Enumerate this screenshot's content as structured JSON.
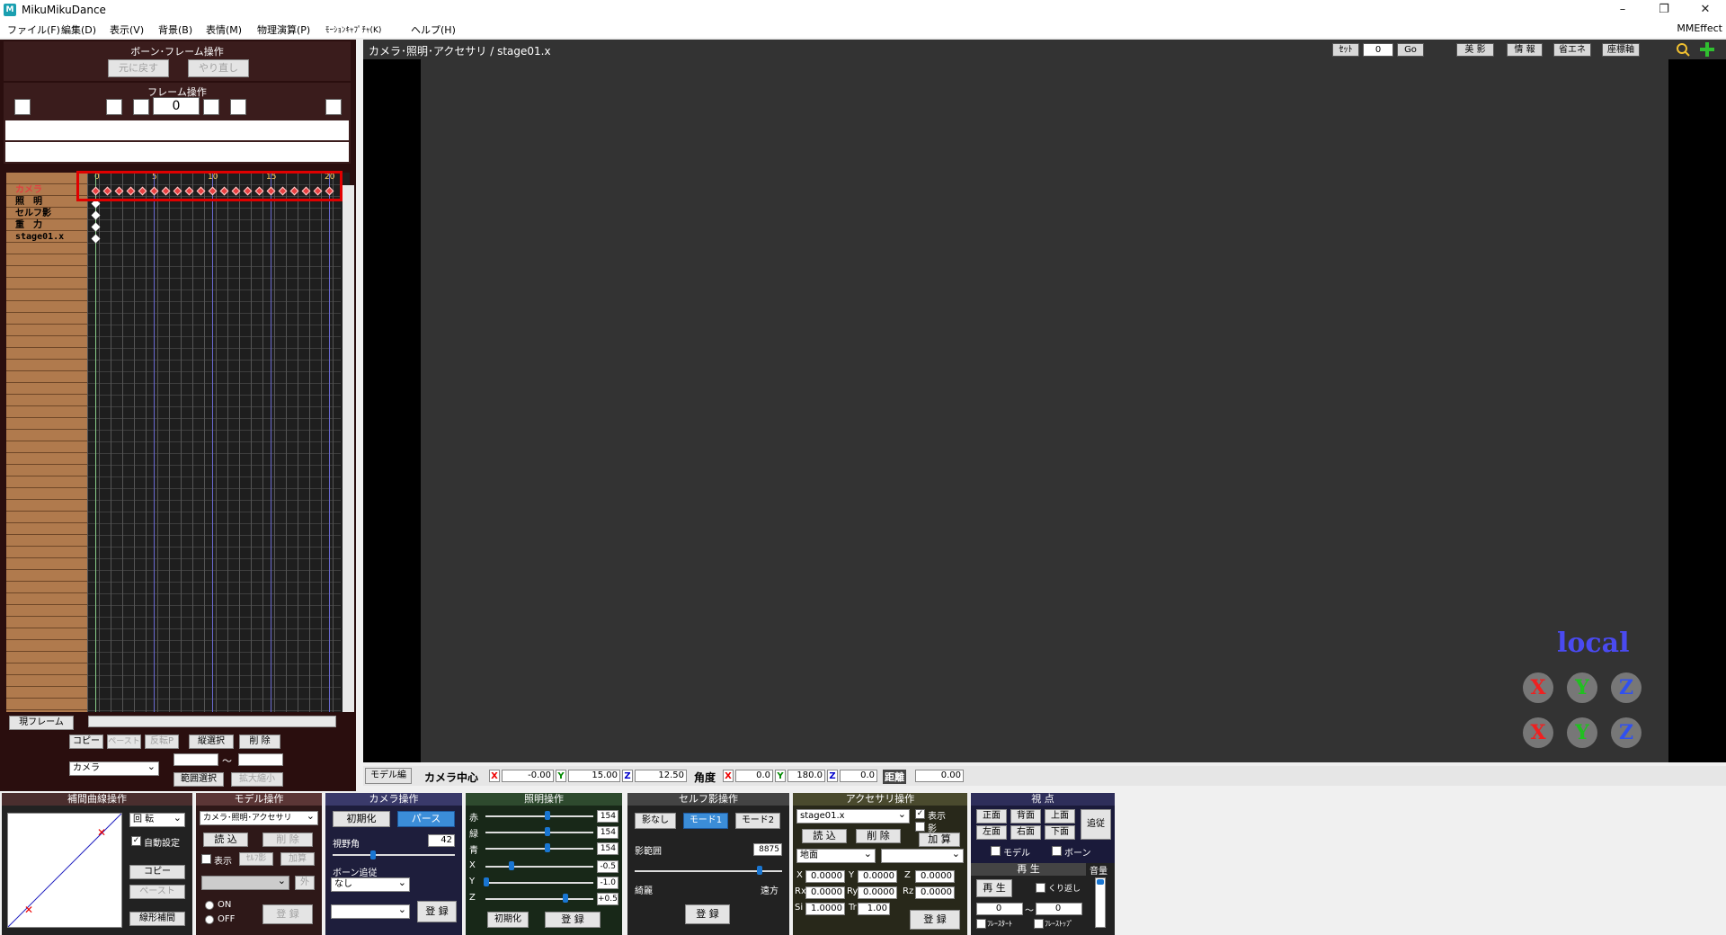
{
  "titlebar": {
    "app_title": "MikuMikuDance",
    "icon_text": "M",
    "min": "–",
    "max": "❐",
    "close": "✕"
  },
  "menu": [
    "ファイル(F)",
    "編集(D)",
    "表示(V)",
    "背景(B)",
    "表情(M)",
    "物理演算(P)",
    "ﾓｰｼｮﾝｷｬﾌﾟﾁｬ(K)",
    "ヘルプ(H)"
  ],
  "menu_right": "MMEffect",
  "bone_frame": {
    "title": "ボーン･フレーム操作",
    "undo": "元に戻す",
    "redo": "やり直し"
  },
  "frame_ops": {
    "title": "フレーム操作",
    "frame_value": "0",
    "first": "|<",
    "prev_key": ".<",
    "prev": "<",
    "next": ">",
    "next_key": ">.",
    "last": ">|"
  },
  "timeline": {
    "ticks": [
      "0",
      "5",
      "10",
      "15",
      "20"
    ],
    "rows": [
      "カメラ",
      "照　明",
      "セルフ影",
      "重　力",
      "stage01.x"
    ]
  },
  "frame_bottom": {
    "current_frame": "現フレーム",
    "copy": "コピー",
    "paste": "ペースト",
    "reverse_paste": "反転P",
    "vert_select": "縦選択",
    "delete": "削 除",
    "target": "カメラ",
    "range_from": "",
    "range_to": "",
    "tilde": "～",
    "range_select": "範囲選択",
    "expand": "拡大縮小"
  },
  "viewport": {
    "title": "カメラ･照明･アクセサリ / stage01.x",
    "set_label": "ｾｯﾄ",
    "set_value": "0",
    "go": "Go",
    "beauty": "美 影",
    "info": "情 報",
    "eco": "省エネ",
    "coord": "座標軸",
    "local_label": "local",
    "gizmo_top": [
      "X",
      "Y",
      "Z"
    ],
    "gizmo_bottom": [
      "X",
      "Y",
      "Z"
    ]
  },
  "camstatus": {
    "model_edit": "モデル編",
    "center_label": "カメラ中心",
    "cx": "-0.00",
    "cy": "15.00",
    "cz": "12.50",
    "angle_label": "角度",
    "ax": "0.0",
    "ay": "180.0",
    "az": "0.0",
    "dist_label": "距離",
    "dist": "0.00",
    "x": "X",
    "y": "Y",
    "z": "Z"
  },
  "interp": {
    "title": "補間曲線操作",
    "rotate": "回 転",
    "auto": "自動設定",
    "copy": "コピー",
    "paste": "ペースト",
    "linear": "線形補間"
  },
  "model_ops": {
    "title": "モデル操作",
    "model_select": "カメラ･照明･アクセサリ",
    "load": "読 込",
    "delete": "削 除",
    "show": "表示",
    "self_shadow": "ｾﾙﾌ影",
    "add": "加算",
    "outer": "外",
    "on": "ON",
    "off": "OFF",
    "register": "登 録"
  },
  "camera_ops": {
    "title": "カメラ操作",
    "init": "初期化",
    "perspective": "パース",
    "fov_label": "視野角",
    "fov": "42",
    "follow_label": "ボーン追従",
    "follow_value": "なし",
    "register": "登 録"
  },
  "light_ops": {
    "title": "照明操作",
    "r_label": "赤",
    "g_label": "緑",
    "b_label": "青",
    "r": "154",
    "g": "154",
    "b": "154",
    "x_label": "X",
    "y_label": "Y",
    "z_label": "Z",
    "x": "-0.5",
    "y": "-1.0",
    "z": "+0.5",
    "init": "初期化",
    "register": "登 録"
  },
  "self_shadow": {
    "title": "セルフ影操作",
    "none": "影なし",
    "mode1": "モード1",
    "mode2": "モード2",
    "range_label": "影範囲",
    "range_value": "8875",
    "near": "綺麗",
    "far": "遠方",
    "register": "登 録"
  },
  "accessory": {
    "title": "アクセサリ操作",
    "name": "stage01.x",
    "show": "表示",
    "shadow": "影",
    "load": "読 込",
    "delete": "削 除",
    "add": "加 算",
    "ground": "地面",
    "x": "0.0000",
    "y": "0.0000",
    "z": "0.0000",
    "rx": "0.0000",
    "ry": "0.0000",
    "rz": "0.0000",
    "si": "1.0000",
    "tr": "1.00",
    "x_label": "X",
    "y_label": "Y",
    "z_label": "Z",
    "rx_label": "Rx",
    "ry_label": "Ry",
    "rz_label": "Rz",
    "si_label": "Si",
    "tr_label": "Tr",
    "register": "登 録"
  },
  "viewpoint": {
    "title": "視 点",
    "front": "正面",
    "back": "背面",
    "top": "上面",
    "follow": "追従",
    "left": "左面",
    "right": "右面",
    "bottom": "下面",
    "model": "モデル",
    "bone": "ボーン"
  },
  "playback": {
    "title": "再 生",
    "play": "再 生",
    "repeat": "くり返し",
    "from": "0",
    "to": "0",
    "tilde": "～",
    "frame_start": "ﾌﾚｰｽﾀｰﾄ",
    "frame_stop": "ﾌﾚｰｽﾄｯﾌﾟ",
    "volume": "音量"
  }
}
